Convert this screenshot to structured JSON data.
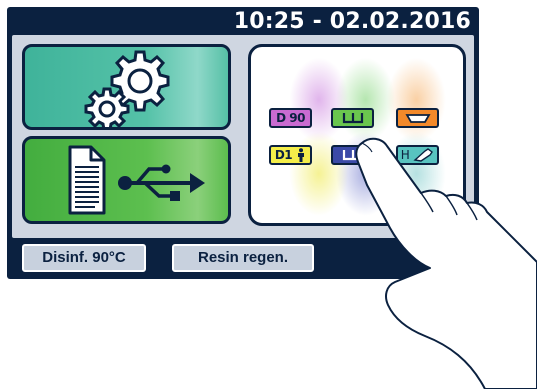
{
  "header": {
    "datetime": "10:25 - 02.02.2016"
  },
  "panels": {
    "settings": {
      "icon": "gears-icon"
    },
    "usb_export": {
      "icons": [
        "document-icon",
        "usb-icon"
      ]
    }
  },
  "programs": [
    {
      "label": "D 90",
      "icon": "",
      "color": "#c96bd1"
    },
    {
      "label": "",
      "icon": "w-tray-icon",
      "color": "#6ac64e"
    },
    {
      "label": "",
      "icon": "basin-icon",
      "color": "#f3892a"
    },
    {
      "label": "D1",
      "icon": "person-icon",
      "color": "#f4ee4a"
    },
    {
      "label": "",
      "icon": "w-tray-icon",
      "color": "#3b4aa7"
    },
    {
      "label": "H",
      "icon": "handpiece-icon",
      "color": "#58c3c0"
    }
  ],
  "taskbar": {
    "disinf_label": "Disinf. 90°C",
    "resin_label": "Resin regen."
  }
}
